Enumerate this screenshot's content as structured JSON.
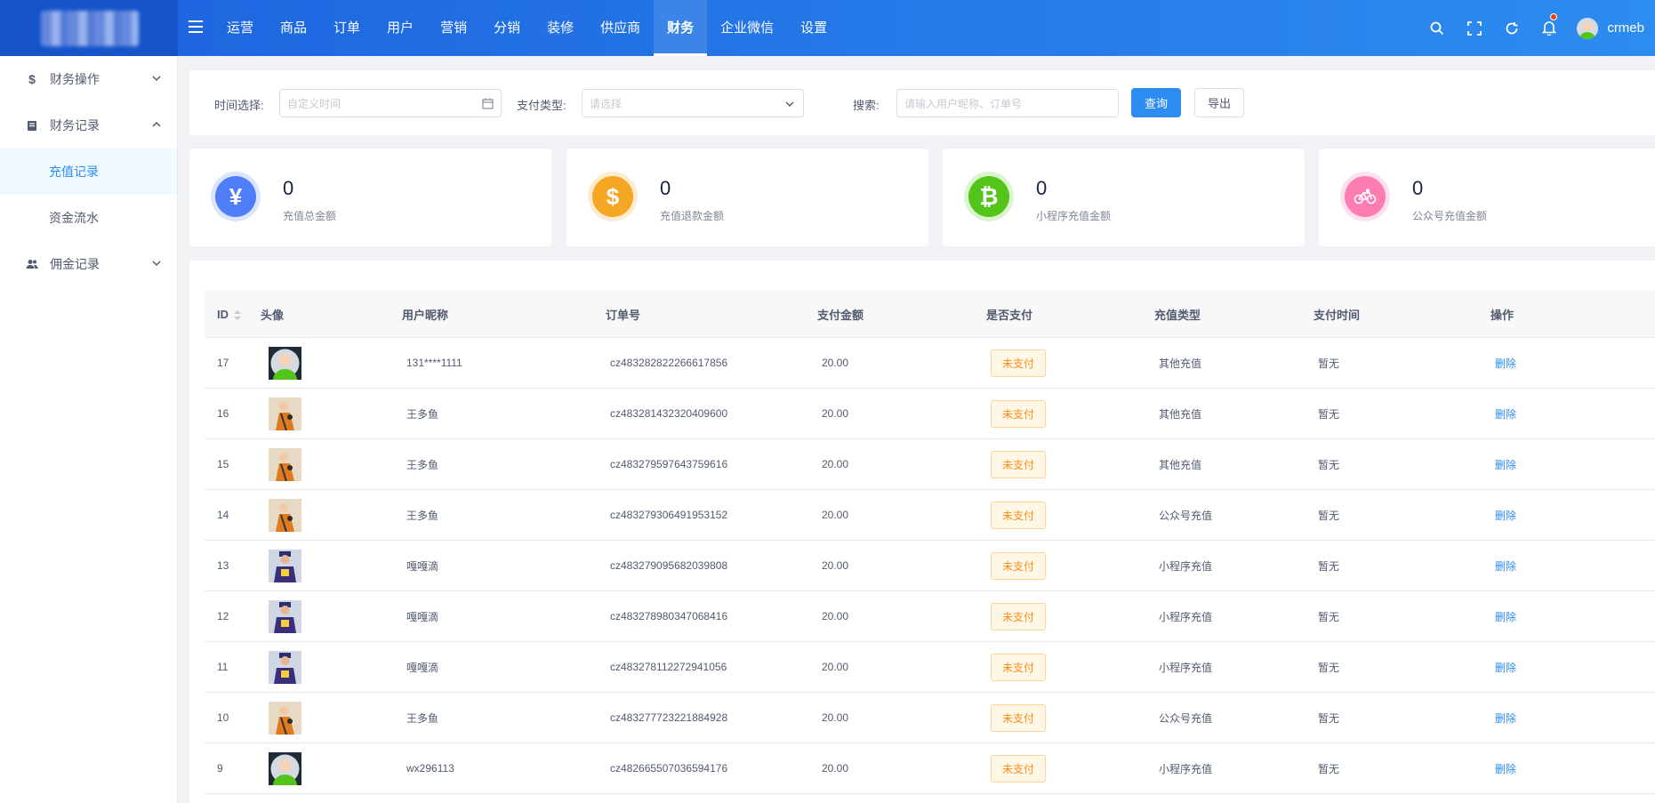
{
  "header": {
    "nav": [
      "运营",
      "商品",
      "订单",
      "用户",
      "营销",
      "分销",
      "装修",
      "供应商",
      "财务",
      "企业微信",
      "设置"
    ],
    "active_nav": "财务",
    "user_name": "crmeb"
  },
  "sidebar": {
    "groups": [
      {
        "label": "财务操作",
        "icon": "dollar-icon",
        "expanded": false
      },
      {
        "label": "财务记录",
        "icon": "book-icon",
        "expanded": true
      },
      {
        "label": "佣金记录",
        "icon": "users-icon",
        "expanded": false
      }
    ],
    "sub_items": [
      "充值记录",
      "资金流水"
    ],
    "active_sub": "充值记录"
  },
  "filters": {
    "time_label": "时间选择:",
    "time_placeholder": "自定义时间",
    "pay_type_label": "支付类型:",
    "pay_type_placeholder": "请选择",
    "search_label": "搜索:",
    "search_placeholder": "请输入用户昵称、订单号",
    "query_button": "查询",
    "export_button": "导出"
  },
  "stats": [
    {
      "value": "0",
      "label": "充值总金额",
      "icon": "yen-icon",
      "color": "#4f7ef8"
    },
    {
      "value": "0",
      "label": "充值退款金额",
      "icon": "dollar-icon",
      "color": "#f5a623"
    },
    {
      "value": "0",
      "label": "小程序充值金额",
      "icon": "bitcoin-icon",
      "color": "#52c41a"
    },
    {
      "value": "0",
      "label": "公众号充值金额",
      "icon": "bicycle-icon",
      "color": "#fd7db3"
    }
  ],
  "table": {
    "headers": [
      "ID",
      "头像",
      "用户昵称",
      "订单号",
      "支付金额",
      "是否支付",
      "充值类型",
      "支付时间",
      "操作"
    ],
    "rows": [
      {
        "id": "17",
        "avatar": "default-avatar",
        "nick": "131****1111",
        "order": "cz483282822266617856",
        "amount": "20.00",
        "paid": "未支付",
        "type": "其他充值",
        "time": "暂无",
        "op": "删除"
      },
      {
        "id": "16",
        "avatar": "orange-avatar",
        "nick": "王多鱼",
        "order": "cz483281432320409600",
        "amount": "20.00",
        "paid": "未支付",
        "type": "其他充值",
        "time": "暂无",
        "op": "删除"
      },
      {
        "id": "15",
        "avatar": "orange-avatar",
        "nick": "王多鱼",
        "order": "cz483279597643759616",
        "amount": "20.00",
        "paid": "未支付",
        "type": "其他充值",
        "time": "暂无",
        "op": "删除"
      },
      {
        "id": "14",
        "avatar": "orange-avatar",
        "nick": "王多鱼",
        "order": "cz483279306491953152",
        "amount": "20.00",
        "paid": "未支付",
        "type": "公众号充值",
        "time": "暂无",
        "op": "删除"
      },
      {
        "id": "13",
        "avatar": "purple-avatar",
        "nick": "嘎嘎滴",
        "order": "cz483279095682039808",
        "amount": "20.00",
        "paid": "未支付",
        "type": "小程序充值",
        "time": "暂无",
        "op": "删除"
      },
      {
        "id": "12",
        "avatar": "purple-avatar",
        "nick": "嘎嘎滴",
        "order": "cz483278980347068416",
        "amount": "20.00",
        "paid": "未支付",
        "type": "小程序充值",
        "time": "暂无",
        "op": "删除"
      },
      {
        "id": "11",
        "avatar": "purple-avatar",
        "nick": "嘎嘎滴",
        "order": "cz483278112272941056",
        "amount": "20.00",
        "paid": "未支付",
        "type": "小程序充值",
        "time": "暂无",
        "op": "删除"
      },
      {
        "id": "10",
        "avatar": "orange-avatar",
        "nick": "王多鱼",
        "order": "cz483277723221884928",
        "amount": "20.00",
        "paid": "未支付",
        "type": "公众号充值",
        "time": "暂无",
        "op": "删除"
      },
      {
        "id": "9",
        "avatar": "default-avatar",
        "nick": "wx296113",
        "order": "cz482665507036594176",
        "amount": "20.00",
        "paid": "未支付",
        "type": "小程序充值",
        "time": "暂无",
        "op": "删除"
      }
    ]
  }
}
